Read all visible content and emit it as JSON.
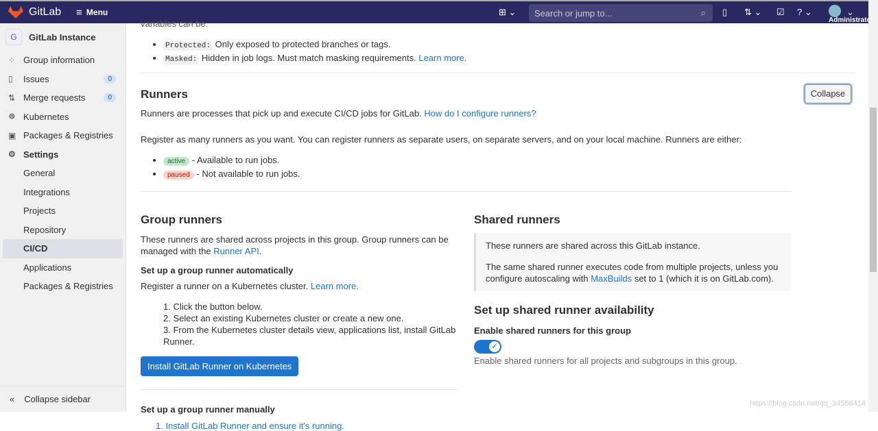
{
  "topbar": {
    "brand": "GitLab",
    "menu": "Menu",
    "search_placeholder": "Search or jump to...",
    "user": "Administrator"
  },
  "sidebar": {
    "instance_initial": "G",
    "instance": "GitLab Instance",
    "items": [
      {
        "label": "Group information"
      },
      {
        "label": "Issues",
        "badge": "0"
      },
      {
        "label": "Merge requests",
        "badge": "0"
      },
      {
        "label": "Kubernetes"
      },
      {
        "label": "Packages & Registries"
      },
      {
        "label": "Settings"
      }
    ],
    "sub": [
      "General",
      "Integrations",
      "Projects",
      "Repository",
      "CI/CD",
      "Applications",
      "Packages & Registries"
    ],
    "collapse": "Collapse sidebar"
  },
  "variables": {
    "intro": "variables can be:",
    "protected_code": "Protected:",
    "protected_text": "Only exposed to protected branches or tags.",
    "masked_code": "Masked:",
    "masked_text": "Hidden in job logs. Must match masking requirements.",
    "learn_more": "Learn more."
  },
  "runners": {
    "title": "Runners",
    "collapse": "Collapse",
    "desc": "Runners are processes that pick up and execute CI/CD jobs for GitLab.",
    "how_link": "How do I configure runners?",
    "register": "Register as many runners as you want. You can register runners as separate users, on separate servers, and on your local machine. Runners are either:",
    "active": "active",
    "active_text": "- Available to run jobs.",
    "paused": "paused",
    "paused_text": "- Not available to run jobs."
  },
  "group": {
    "title": "Group runners",
    "desc": "These runners are shared across projects in this group. Group runners can be managed with the",
    "api_link": "Runner API",
    "desc_end": ".",
    "auto_title": "Set up a group runner automatically",
    "auto_desc": "Register a runner on a Kubernetes cluster.",
    "learn_more": "Learn more.",
    "steps": [
      "1. Click the button below.",
      "2. Select an existing Kubernetes cluster or create a new one.",
      "3. From the Kubernetes cluster details view, applications list, install GitLab Runner."
    ],
    "install_button": "Install GitLab Runner on Kubernetes",
    "manual_title": "Set up a group runner manually",
    "manual_step": "1. Install GitLab Runner and ensure it's running."
  },
  "shared": {
    "title": "Shared runners",
    "p1": "These runners are shared across this GitLab instance.",
    "p2a": "The same shared runner executes code from multiple projects, unless you configure autoscaling with",
    "maxbuilds": "MaxBuilds",
    "p2b": "set to 1 (which it is on GitLab.com).",
    "avail_title": "Set up shared runner availability",
    "enable_label": "Enable shared runners for this group",
    "enabled": true,
    "enable_help": "Enable shared runners for all projects and subgroups in this group."
  },
  "watermark": "https://blog.csdn.net/qq_34556414"
}
